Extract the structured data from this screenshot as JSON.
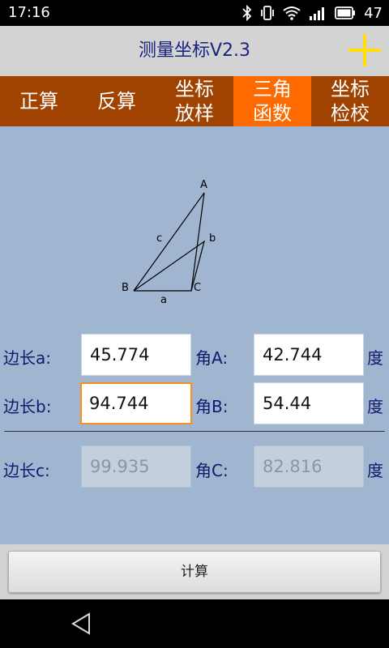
{
  "status_bar": {
    "time": "17:16",
    "battery": "47",
    "icons": [
      "bluetooth-icon",
      "vibrate-icon",
      "wifi-icon",
      "signal-icon",
      "battery-icon"
    ]
  },
  "app": {
    "title": "测量坐标V2.3",
    "add_icon": "plus-icon",
    "accent": "#ffe000"
  },
  "tabs": [
    {
      "line1": "正算",
      "line2": "",
      "active": false
    },
    {
      "line1": "反算",
      "line2": "",
      "active": false
    },
    {
      "line1": "坐标",
      "line2": "放样",
      "active": false
    },
    {
      "line1": "三角",
      "line2": "函数",
      "active": true
    },
    {
      "line1": "坐标",
      "line2": "检校",
      "active": false
    }
  ],
  "diagram": {
    "vertex_a": "A",
    "vertex_b": "B",
    "vertex_c": "C",
    "side_a": "a",
    "side_b": "b",
    "side_c": "c"
  },
  "form": {
    "side_a_label": "边长a:",
    "side_a_value": "45.774",
    "angle_a_label": "角A:",
    "angle_a_value": "42.744",
    "side_b_label": "边长b:",
    "side_b_value": "94.744",
    "angle_b_label": "角B:",
    "angle_b_value": "54.44",
    "side_c_label": "边长c:",
    "side_c_value": "99.935",
    "angle_c_label": "角C:",
    "angle_c_value": "82.816",
    "degree_unit": "度"
  },
  "actions": {
    "calculate_label": "计算"
  },
  "colors": {
    "tab_bar": "#a14300",
    "tab_active": "#ff6a00",
    "content_bg": "#a0b5d0",
    "label_text": "#0f1a6e"
  }
}
